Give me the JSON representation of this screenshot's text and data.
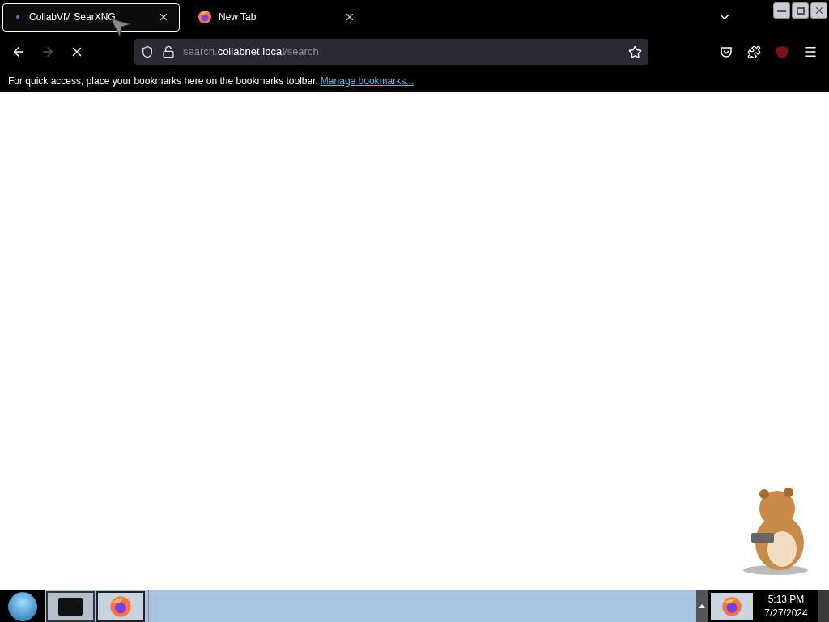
{
  "tabs": [
    {
      "title": "CollabVM SearXNG",
      "selected": true,
      "kind": "dot"
    },
    {
      "title": "New Tab",
      "selected": false,
      "kind": "firefox"
    }
  ],
  "address_bar": {
    "prefix": "search.",
    "domain": "collabnet.local",
    "path": "/search"
  },
  "bookmarks_bar": {
    "message": "For quick access, place your bookmarks here on the bookmarks toolbar.",
    "link": "Manage bookmarks..."
  },
  "taskbar": {
    "items": [
      {
        "kind": "terminal",
        "selected": false
      },
      {
        "kind": "firefox",
        "selected": true
      }
    ],
    "time": "5:13 PM",
    "date": "7/27/2024"
  }
}
